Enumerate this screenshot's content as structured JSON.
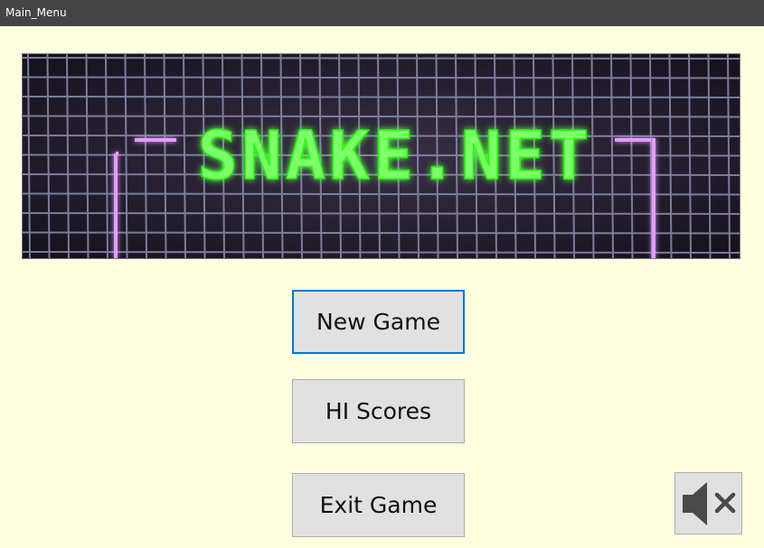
{
  "window": {
    "title": "Main_Menu"
  },
  "banner": {
    "logo_text": "SNAKE.NET",
    "colors": {
      "background": "#221a2a",
      "grid": "#8a8fb0",
      "logo": "#7dff6a",
      "logo_glow": "#1aff00",
      "walls": "#e59bff"
    }
  },
  "menu": {
    "new_game_label": "New Game",
    "hi_scores_label": "HI Scores",
    "exit_game_label": "Exit Game"
  },
  "sound": {
    "icon": "speaker-muted-icon",
    "muted": true
  },
  "colors": {
    "window_background": "#ffffe0",
    "titlebar": "#444444",
    "button_face": "#e1e1e1",
    "focus_border": "#0078d7"
  }
}
